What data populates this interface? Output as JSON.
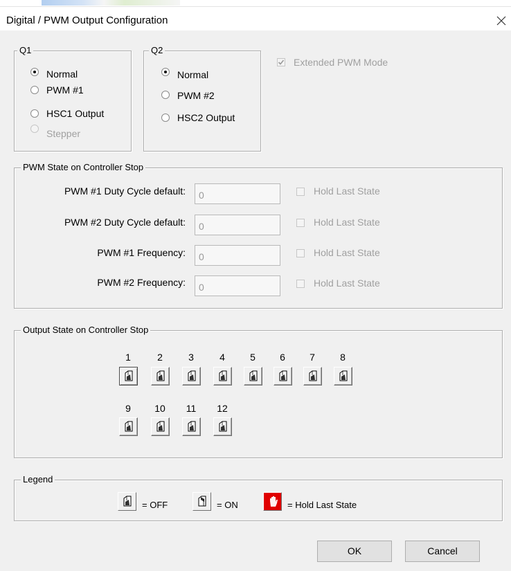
{
  "window": {
    "title": "Digital / PWM Output Configuration"
  },
  "q1": {
    "title": "Q1",
    "options": [
      "Normal",
      "PWM #1",
      "HSC1 Output",
      "Stepper"
    ],
    "selected": "Normal",
    "disabled_option": "Stepper"
  },
  "q2": {
    "title": "Q2",
    "options": [
      "Normal",
      "PWM #2",
      "HSC2 Output"
    ],
    "selected": "Normal"
  },
  "extended_pwm": {
    "label": "Extended PWM Mode",
    "checked": true,
    "disabled": true
  },
  "pwm_state": {
    "title": "PWM State on Controller Stop",
    "rows": [
      {
        "label": "PWM #1 Duty Cycle default:",
        "value": "0",
        "hold_label": "Hold Last State"
      },
      {
        "label": "PWM #2 Duty Cycle default:",
        "value": "0",
        "hold_label": "Hold Last State"
      },
      {
        "label": "PWM #1 Frequency:",
        "value": "0",
        "hold_label": "Hold Last State"
      },
      {
        "label": "PWM #2 Frequency:",
        "value": "0",
        "hold_label": "Hold Last State"
      }
    ]
  },
  "output_state": {
    "title": "Output State on Controller Stop",
    "outputs": [
      "1",
      "2",
      "3",
      "4",
      "5",
      "6",
      "7",
      "8",
      "9",
      "10",
      "11",
      "12"
    ],
    "states": [
      "OFF",
      "OFF",
      "OFF",
      "OFF",
      "OFF",
      "OFF",
      "OFF",
      "OFF",
      "OFF",
      "OFF",
      "OFF",
      "OFF"
    ]
  },
  "legend": {
    "title": "Legend",
    "off_label": "= OFF",
    "on_label": "= ON",
    "hold_label": "= Hold Last State",
    "hold_color": "#e00000"
  },
  "buttons": {
    "ok": "OK",
    "cancel": "Cancel"
  },
  "icons": {
    "off": "switch-off-icon",
    "on": "switch-on-icon",
    "hold": "hand-stop-icon",
    "close": "close-icon"
  }
}
